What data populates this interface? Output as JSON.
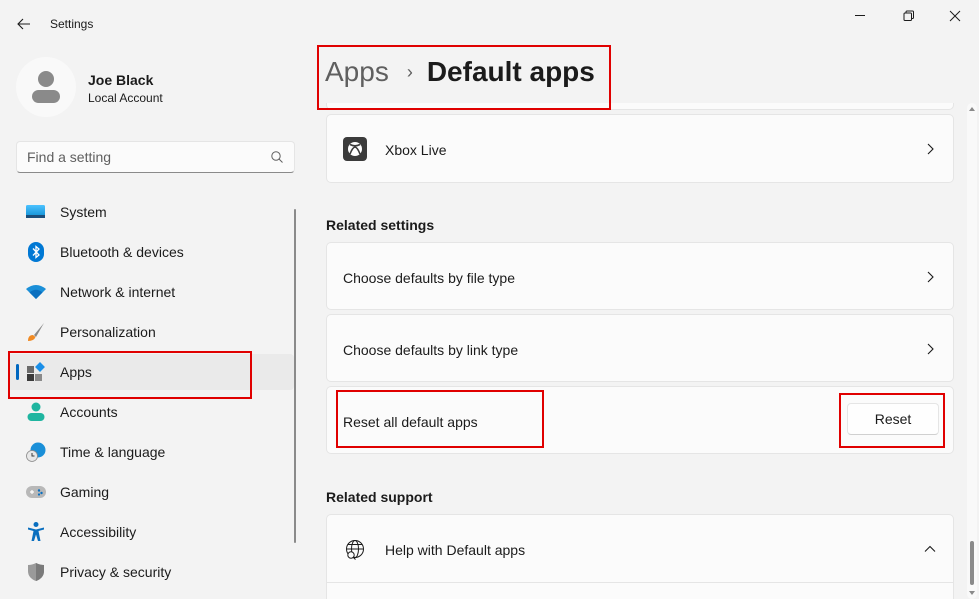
{
  "window": {
    "title": "Settings",
    "controls": {
      "minimize": "minimize-icon",
      "maximize": "restore-icon",
      "close": "close-icon"
    }
  },
  "profile": {
    "name": "Joe Black",
    "account_type": "Local Account"
  },
  "search": {
    "placeholder": "Find a setting",
    "value": ""
  },
  "sidebar": {
    "items": [
      {
        "label": "System",
        "icon": "system-icon",
        "active": false
      },
      {
        "label": "Bluetooth & devices",
        "icon": "bluetooth-icon",
        "active": false
      },
      {
        "label": "Network & internet",
        "icon": "wifi-icon",
        "active": false
      },
      {
        "label": "Personalization",
        "icon": "brush-icon",
        "active": false
      },
      {
        "label": "Apps",
        "icon": "apps-icon",
        "active": true
      },
      {
        "label": "Accounts",
        "icon": "accounts-icon",
        "active": false
      },
      {
        "label": "Time & language",
        "icon": "globe-clock-icon",
        "active": false
      },
      {
        "label": "Gaming",
        "icon": "gamepad-icon",
        "active": false
      },
      {
        "label": "Accessibility",
        "icon": "accessibility-icon",
        "active": false
      },
      {
        "label": "Privacy & security",
        "icon": "shield-icon",
        "active": false
      }
    ]
  },
  "breadcrumb": {
    "parent": "Apps",
    "separator": "›",
    "current": "Default apps"
  },
  "main": {
    "xbox_item": {
      "label": "Xbox Live",
      "icon": "xbox-icon"
    },
    "related_settings": {
      "title": "Related settings",
      "items": [
        {
          "label": "Choose defaults by file type"
        },
        {
          "label": "Choose defaults by link type"
        }
      ],
      "reset": {
        "label": "Reset all default apps",
        "button_label": "Reset"
      }
    },
    "related_support": {
      "title": "Related support",
      "help": {
        "label": "Help with Default apps",
        "icon": "globe-search-icon",
        "expanded": true
      }
    }
  },
  "colors": {
    "accent": "#0067c0",
    "highlight": "#e00000",
    "background": "#f3f3f3",
    "card": "#fbfbfb"
  }
}
